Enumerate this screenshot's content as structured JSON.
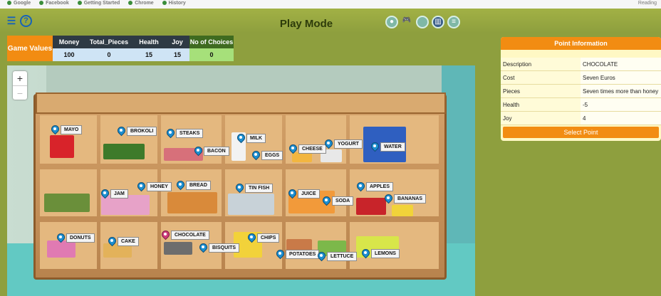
{
  "bookmarks": [
    "Google",
    "Facebook",
    "Getting Started",
    "Chrome",
    "History"
  ],
  "bookmarks_right": "Reading",
  "header": {
    "title": "Play Mode"
  },
  "game_values": {
    "label": "Game Values",
    "columns": [
      "Money",
      "Total_Pieces",
      "Health",
      "Joy",
      "No of Choices"
    ],
    "values": [
      "100",
      "0",
      "15",
      "15",
      "0"
    ]
  },
  "zoom": {
    "in": "+",
    "out": "−"
  },
  "markers": [
    {
      "label": "MAYO"
    },
    {
      "label": "BROKOLI"
    },
    {
      "label": "STEAKS"
    },
    {
      "label": "BACON"
    },
    {
      "label": "MILK"
    },
    {
      "label": "EGGS"
    },
    {
      "label": "CHEESE"
    },
    {
      "label": "YOGURT"
    },
    {
      "label": "WATER"
    },
    {
      "label": "JAM"
    },
    {
      "label": "HONEY"
    },
    {
      "label": "BREAD"
    },
    {
      "label": "TIN FISH"
    },
    {
      "label": "JUICE"
    },
    {
      "label": "SODA"
    },
    {
      "label": "APPLES"
    },
    {
      "label": "BANANAS"
    },
    {
      "label": "DONUTS"
    },
    {
      "label": "CAKE"
    },
    {
      "label": "CHOCOLATE"
    },
    {
      "label": "BISQUITS"
    },
    {
      "label": "CHIPS"
    },
    {
      "label": "POTATOES"
    },
    {
      "label": "LETTUCE"
    },
    {
      "label": "LEMONS"
    }
  ],
  "point_info": {
    "title": "Point Information",
    "rows": [
      {
        "key": "Description",
        "value": "CHOCOLATE"
      },
      {
        "key": "Cost",
        "value": "Seven Euros"
      },
      {
        "key": "Pieces",
        "value": "Seven times more than honey"
      },
      {
        "key": "Health",
        "value": "-5"
      },
      {
        "key": "Joy",
        "value": "4"
      }
    ],
    "button": "Select Point"
  },
  "colors": {
    "accent": "#f28c12",
    "marker": "#1d8fd0",
    "selected_marker": "#d03a7a"
  }
}
